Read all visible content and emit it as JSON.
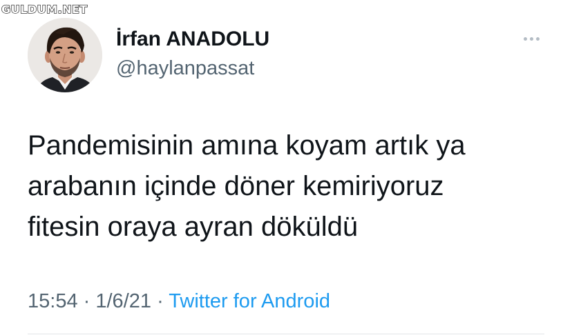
{
  "watermark": "GULDUM.NET",
  "tweet": {
    "author": {
      "display_name": "İrfan ANADOLU",
      "handle": "@haylanpassat",
      "avatar_icon": "profile-photo-man"
    },
    "text_lines": [
      "Pandemisinin amına koyam artık ya",
      "arabanın içinde döner kemiriyoruz",
      "fitesin oraya ayran döküldü"
    ],
    "time": "15:54",
    "separator": "·",
    "date": "1/6/21",
    "source": "Twitter for Android",
    "more_icon": "ellipsis-icon"
  },
  "colors": {
    "text_primary": "#0f1419",
    "text_secondary": "#536471",
    "link": "#1d9bf0",
    "divider": "#e3e6e8"
  }
}
